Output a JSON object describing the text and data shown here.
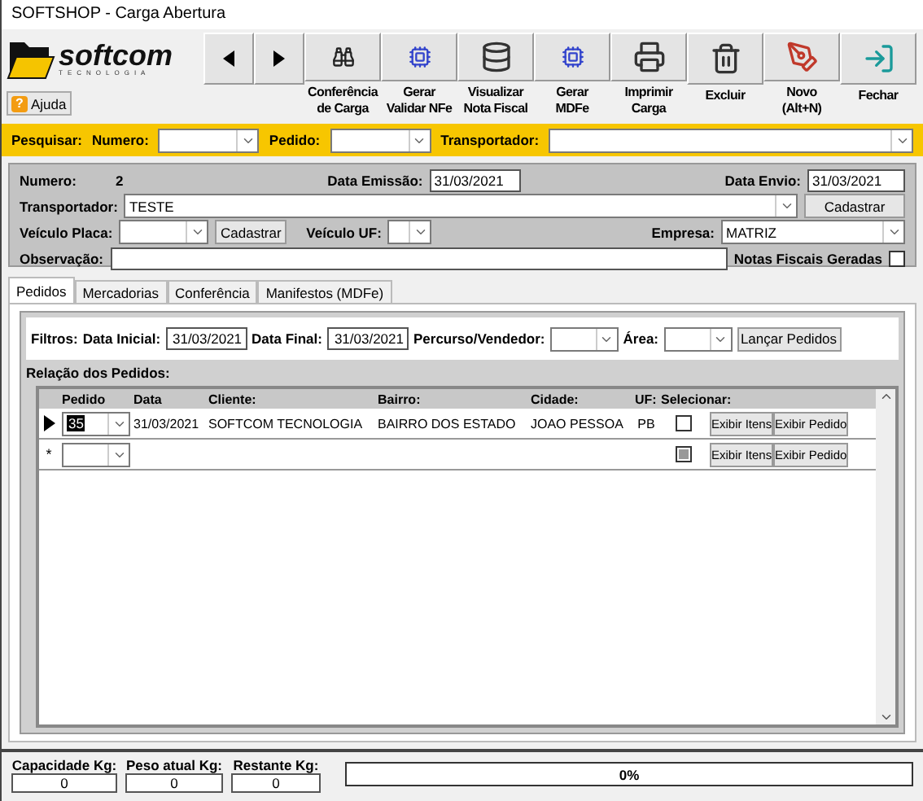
{
  "window": {
    "title": "SOFTSHOP - Carga Abertura"
  },
  "logo": {
    "name": "softcom",
    "tagline": "TECNOLOGIA"
  },
  "help_button": {
    "label": "Ajuda",
    "icon": "?"
  },
  "toolbar": [
    {
      "kind": "prev"
    },
    {
      "kind": "next"
    },
    {
      "kind": "binoculars",
      "label_lines": [
        "Conferência",
        "de Carga"
      ]
    },
    {
      "kind": "chip",
      "label_lines": [
        "Gerar",
        "Validar NFe"
      ]
    },
    {
      "kind": "stack",
      "label_lines": [
        "Visualizar",
        "Nota Fiscal"
      ]
    },
    {
      "kind": "chip",
      "label_lines": [
        "Gerar",
        "MDFe"
      ]
    },
    {
      "kind": "printer",
      "label_lines": [
        "Imprimir",
        "Carga"
      ]
    },
    {
      "kind": "trash",
      "label_lines": [
        "Excluir"
      ]
    },
    {
      "kind": "pen",
      "label_lines": [
        "Novo",
        "(Alt+N)"
      ]
    },
    {
      "kind": "exit",
      "label_lines": [
        "Fechar"
      ]
    }
  ],
  "search_bar": {
    "label": "Pesquisar:",
    "fields": [
      {
        "label": "Numero:"
      },
      {
        "label": "Pedido:"
      },
      {
        "label": "Transportador:"
      }
    ]
  },
  "header": {
    "numero_label": "Numero:",
    "numero": "2",
    "data_emissao_label": "Data Emissão:",
    "data_emissao": "31/03/2021",
    "data_envio_label": "Data Envio:",
    "data_envio": "31/03/2021",
    "transportador_label": "Transportador:",
    "transportador": "TESTE",
    "cadastrar": "Cadastrar",
    "placa_label": "Veículo Placa:",
    "placa_cadastrar": "Cadastrar",
    "uf_label": "Veículo UF:",
    "empresa_label": "Empresa:",
    "empresa": "MATRIZ",
    "observacao_label": "Observação:",
    "notas_label": "Notas Fiscais Geradas",
    "notas_checked": false
  },
  "tabs": [
    {
      "label": "Pedidos",
      "selected": true
    },
    {
      "label": "Mercadorias",
      "selected": false
    },
    {
      "label": "Conferência",
      "selected": false
    },
    {
      "label": "Manifestos (MDFe)",
      "selected": false
    }
  ],
  "filters": {
    "label": "Filtros:",
    "data_inicial_label": "Data Inicial:",
    "data_inicial": "31/03/2021",
    "data_final_label": "Data Final:",
    "data_final": "31/03/2021",
    "percurso_label": "Percurso/Vendedor:",
    "area_label": "Área:",
    "button": "Lançar Pedidos"
  },
  "orders": {
    "title": "Relação dos Pedidos:",
    "columns": [
      "Pedido",
      "Data",
      "Cliente:",
      "Bairro:",
      "Cidade:",
      "UF:",
      "Selecionar:"
    ],
    "rows": [
      {
        "kind": "current",
        "pedido": "35",
        "data": "31/03/2021",
        "cliente": "SOFTCOM TECNOLOGIA",
        "bairro": "BAIRRO DOS ESTADO",
        "cidade": "JOAO PESSOA",
        "uf": "PB",
        "checked": false,
        "indeterminate": false,
        "items_button": "Exibir Itens",
        "order_button": "Exibir Pedido"
      },
      {
        "kind": "new",
        "indicator": "*",
        "checked": false,
        "indeterminate": true,
        "items_button": "Exibir Itens",
        "order_button": "Exibir Pedido"
      }
    ]
  },
  "footer": {
    "fields": [
      {
        "label": "Capacidade Kg:",
        "value": "0"
      },
      {
        "label": "Peso atual Kg:",
        "value": "0"
      },
      {
        "label": "Restante Kg:",
        "value": "0"
      }
    ],
    "progress_text": "0%",
    "level": 0
  }
}
